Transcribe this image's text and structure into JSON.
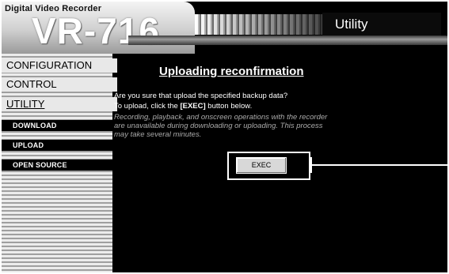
{
  "header": {
    "brand": "Digital Video Recorder",
    "model": "VR-716",
    "section_title": "Utility"
  },
  "sidebar": {
    "items": [
      {
        "label": "CONFIGURATION",
        "type": "main"
      },
      {
        "label": "CONTROL",
        "type": "main"
      },
      {
        "label": "UTILITY",
        "type": "main",
        "active": true
      },
      {
        "label": "DOWNLOAD",
        "type": "sub"
      },
      {
        "label": "UPLOAD",
        "type": "sub"
      },
      {
        "label": "OPEN SOURCE",
        "type": "sub"
      }
    ]
  },
  "main": {
    "heading": "Uploading reconfirmation",
    "question": "Are you sure that upload the specified backup data?",
    "instruction_prefix": "To upload, click the ",
    "instruction_keyword": "[EXEC]",
    "instruction_suffix": " button below.",
    "note_line1": "Recording, playback, and onscreen operations with the recorder",
    "note_line2": "are unavailable during downloading or uploading. This process",
    "note_line3": "may take several minutes.",
    "exec_label": "EXEC"
  }
}
